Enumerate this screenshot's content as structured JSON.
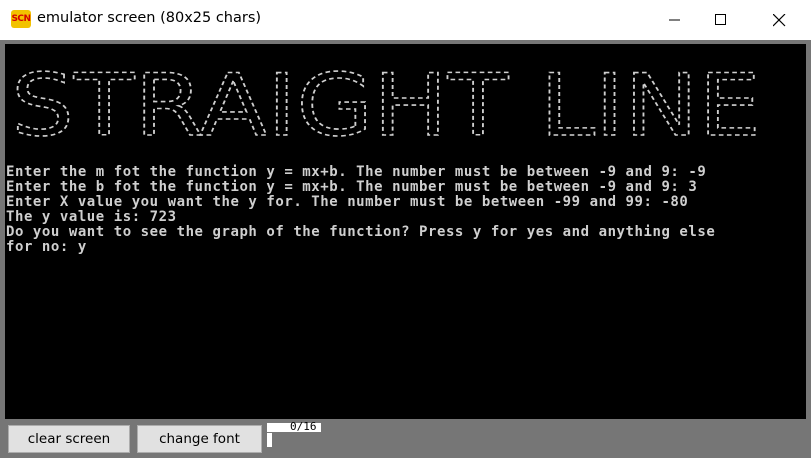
{
  "window": {
    "title": "emulator screen (80x25 chars)",
    "icon_label": "SCN"
  },
  "screen": {
    "banner_text": "STRAIGHT LINE",
    "lines": [
      "Enter the m fot the function y = mx+b. The number must be between -9 and 9: -9",
      "Enter the b fot the function y = mx+b. The number must be between -9 and 9: 3",
      "Enter X value you want the y for. The number must be between -99 and 99: -80",
      "The y value is: 723",
      "Do you want to see the graph of the function? Press y for yes and anything else",
      "for no: y"
    ]
  },
  "controls": {
    "clear_label": "clear screen",
    "font_label": "change font",
    "counter": "0/16"
  },
  "colors": {
    "screen_bg": "#000000",
    "text": "#cfcfcf",
    "frame": "#767676"
  }
}
